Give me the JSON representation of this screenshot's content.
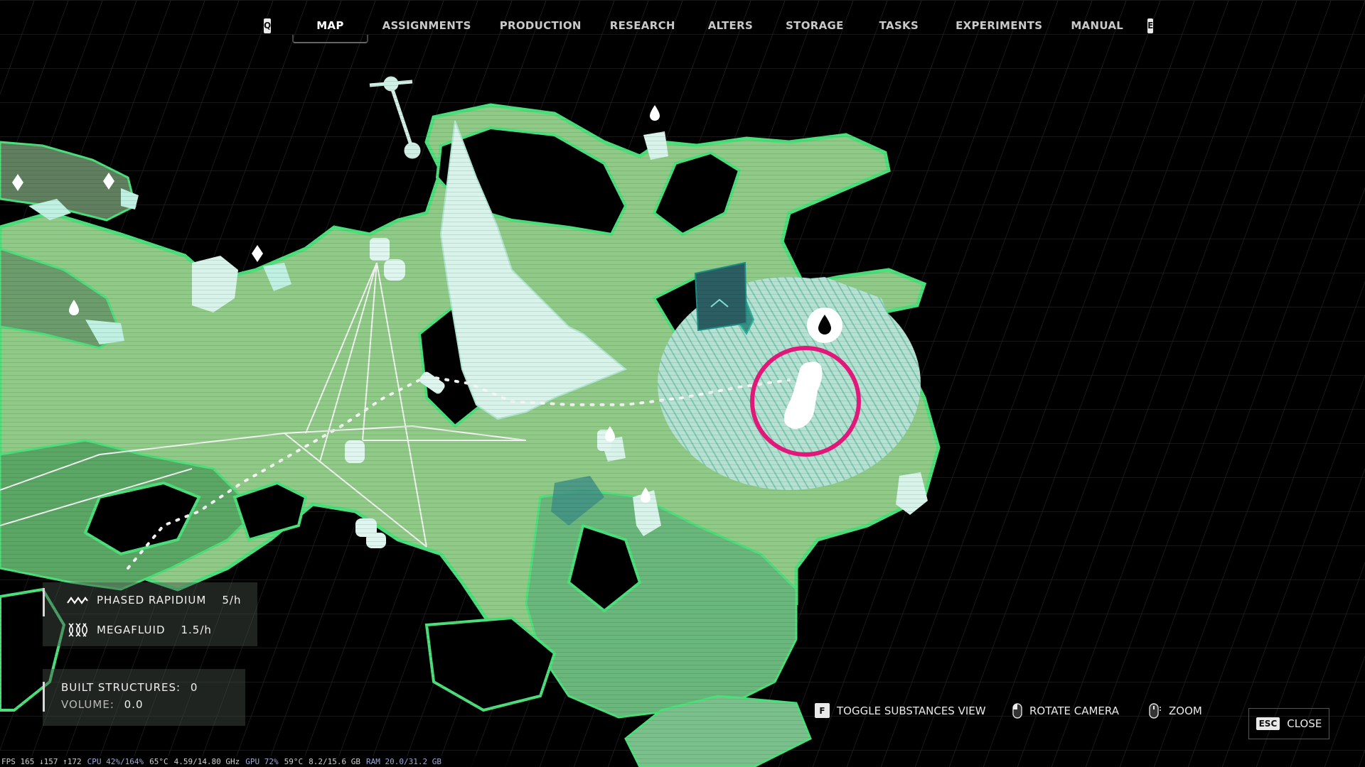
{
  "nav": {
    "prev_key": "Q",
    "next_key": "E",
    "tabs": [
      {
        "label": "MAP",
        "active": true
      },
      {
        "label": "ASSIGNMENTS",
        "active": false
      },
      {
        "label": "PRODUCTION",
        "active": false
      },
      {
        "label": "RESEARCH",
        "active": false
      },
      {
        "label": "ALTERS",
        "active": false
      },
      {
        "label": "STORAGE",
        "active": false
      },
      {
        "label": "TASKS",
        "active": false
      },
      {
        "label": "EXPERIMENTS",
        "active": false
      },
      {
        "label": "MANUAL",
        "active": false
      }
    ]
  },
  "resources": [
    {
      "icon": "wave-icon",
      "name": "PHASED RAPIDIUM",
      "rate": "5/h"
    },
    {
      "icon": "helix-icon",
      "name": "MEGAFLUID",
      "rate": "1.5/h"
    }
  ],
  "built": {
    "structures_label": "BUILT STRUCTURES:",
    "structures_value": "0",
    "volume_label": "VOLUME:",
    "volume_value": "0.0"
  },
  "controls": {
    "toggle_key": "F",
    "toggle_label": "TOGGLE SUBSTANCES VIEW",
    "rotate_label": "ROTATE CAMERA",
    "zoom_label": "ZOOM",
    "close_key": "ESC",
    "close_label": "CLOSE"
  },
  "perf": {
    "fps": "FPS 165 ↓157 ↑172",
    "cpu": "CPU 42%/164%",
    "cpu_temp": "65°C",
    "cpu_clock": "4.59/14.80 GHz",
    "gpu": "GPU 72%",
    "gpu_temp": "59°C",
    "vram": "8.2/15.6 GB",
    "ram": "RAM 20.0/31.2 GB"
  },
  "colors": {
    "terrain": "#8fcb86",
    "terrain_dark": "#5aa764",
    "terrain_edge": "#4be07a",
    "ice": "#d8f4ea",
    "marker_ring": "#e2177a",
    "grid": "#2a2a2a"
  }
}
